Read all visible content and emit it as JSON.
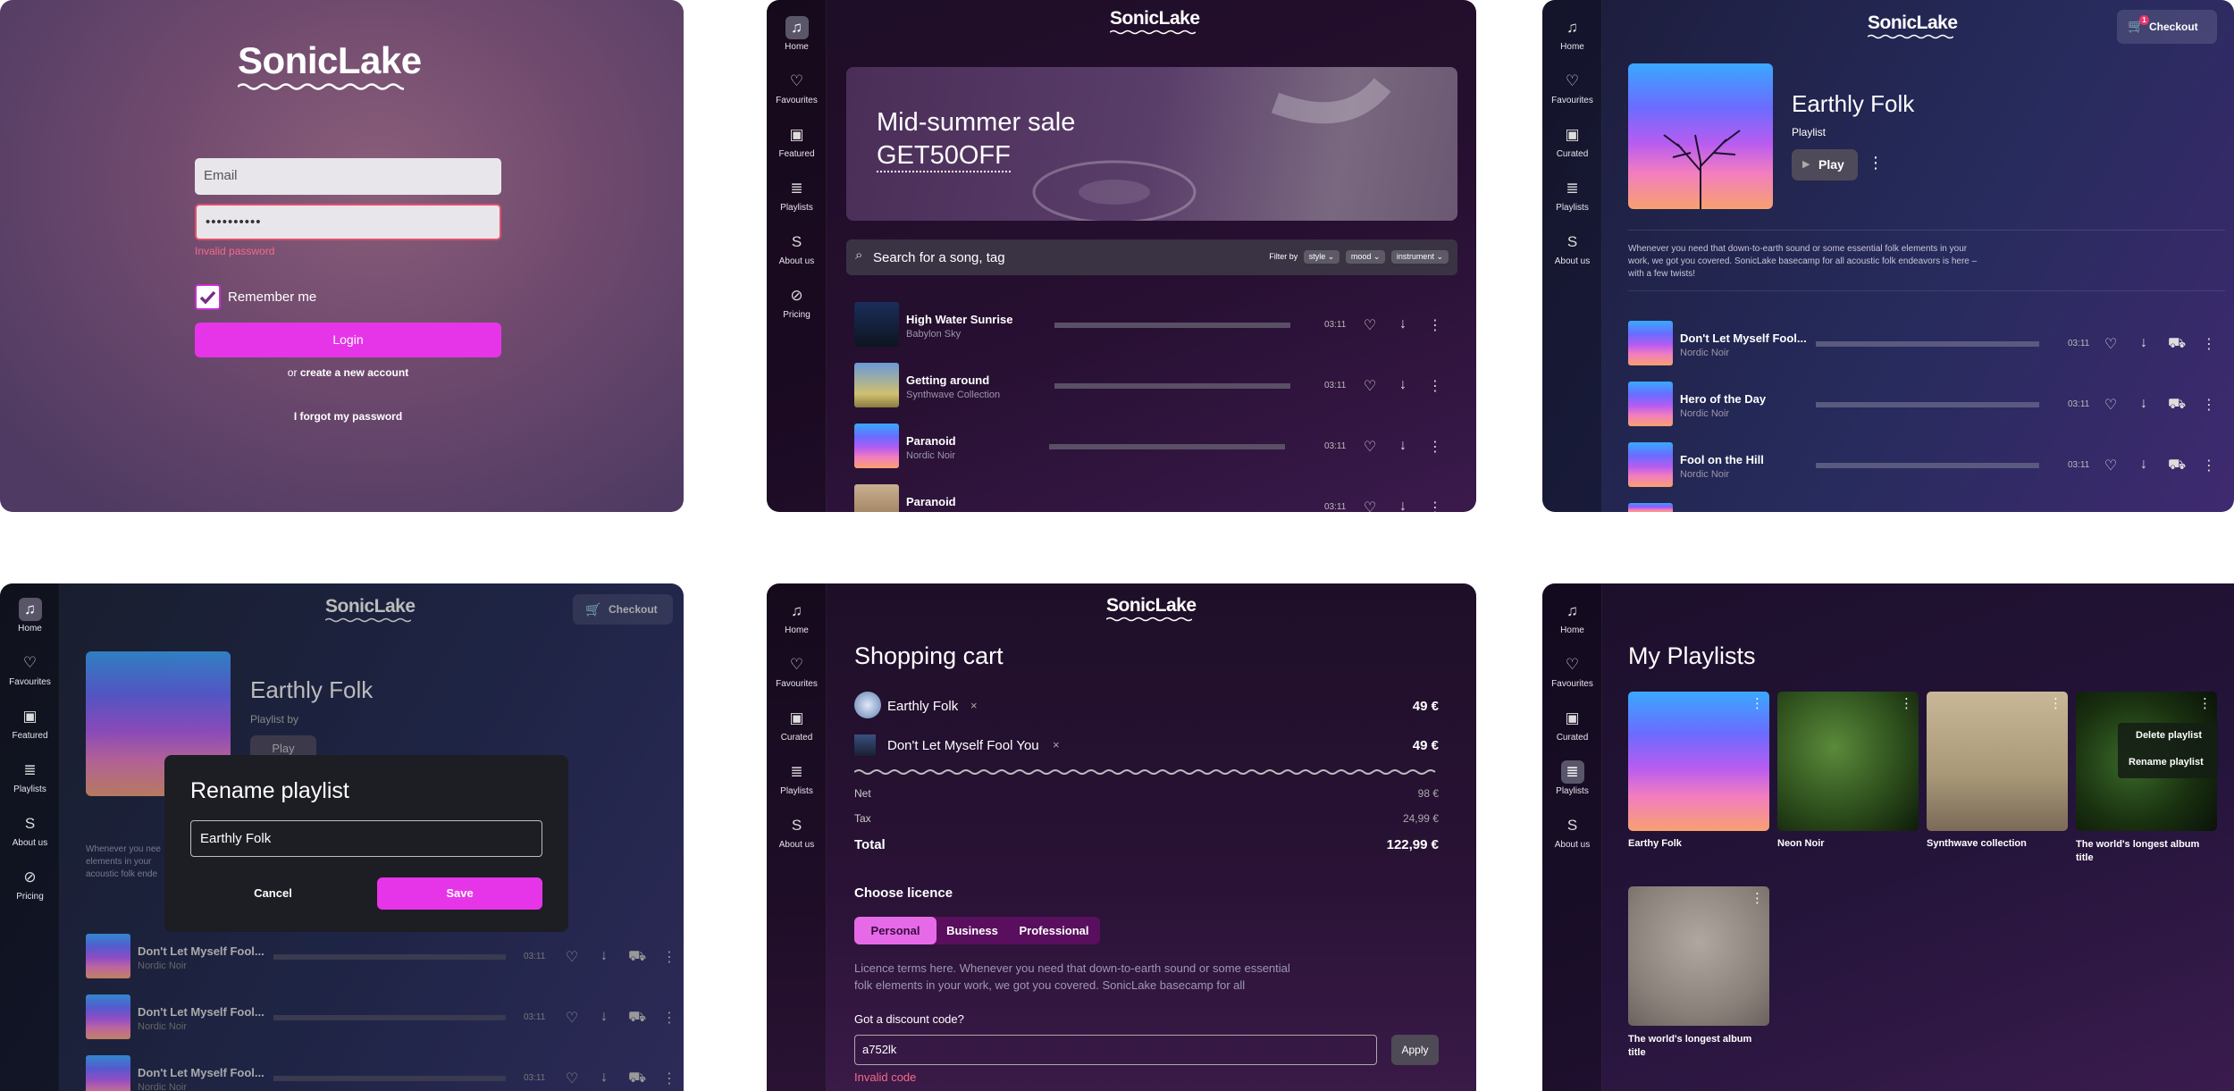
{
  "brand": {
    "name": "SonicLake",
    "accent": "#e635e8"
  },
  "login": {
    "email_placeholder": "Email",
    "password_value": "••••••••••",
    "error": "Invalid password",
    "remember": "Remember me",
    "login_btn": "Login",
    "or_text": "or",
    "create_link": "create a new account",
    "forgot": "I forgot my password"
  },
  "nav_main": [
    {
      "label": "Home",
      "icon": "music-note-icon"
    },
    {
      "label": "Favourites",
      "icon": "heart-icon"
    },
    {
      "label": "Featured",
      "icon": "featured-icon"
    },
    {
      "label": "Playlists",
      "icon": "playlist-icon"
    },
    {
      "label": "About us",
      "icon": "about-icon"
    },
    {
      "label": "Pricing",
      "icon": "pricing-icon"
    }
  ],
  "nav_alt": [
    {
      "label": "Home"
    },
    {
      "label": "Favourites"
    },
    {
      "label": "Curated"
    },
    {
      "label": "Playlists"
    },
    {
      "label": "About us"
    }
  ],
  "browse": {
    "banner_line1": "Mid-summer sale",
    "banner_line2": "GET50OFF",
    "search_placeholder": "Search for a song, tag",
    "filter_by": "Filter by",
    "filters": [
      "style",
      "mood",
      "instrument"
    ],
    "tracks": [
      {
        "title": "High Water Sunrise",
        "artist": "Babylon Sky",
        "duration": "03:11"
      },
      {
        "title": "Getting around",
        "artist": "Synthwave Collection",
        "duration": "03:11"
      },
      {
        "title": "Paranoid",
        "artist": "Nordic Noir",
        "duration": "03:11"
      },
      {
        "title": "Paranoid",
        "artist": "",
        "duration": "03:11"
      }
    ]
  },
  "playlist": {
    "title": "Earthly Folk",
    "type": "Playlist",
    "play": "Play",
    "checkout": "Checkout",
    "cart_count": "1",
    "description": "Whenever you need that down-to-earth sound or some essential folk elements in your work, we got you covered. SonicLake basecamp for all acoustic folk endeavors is here – with a few twists!",
    "tracks": [
      {
        "title": "Don't Let Myself Fool...",
        "artist": "Nordic Noir",
        "duration": "03:11"
      },
      {
        "title": "Hero of the Day",
        "artist": "Nordic Noir",
        "duration": "03:11"
      },
      {
        "title": "Fool on the Hill",
        "artist": "Nordic Noir",
        "duration": "03:11"
      }
    ]
  },
  "rename": {
    "heading": "Rename playlist",
    "value": "Earthly Folk",
    "cancel": "Cancel",
    "save": "Save",
    "bg_title": "Earthly Folk",
    "bg_sub": "Playlist by",
    "bg_play": "Play",
    "checkout": "Checkout",
    "bg_desc": "Whenever you nee elements in your acoustic folk ende",
    "tracks": [
      {
        "title": "Don't Let Myself Fool...",
        "artist": "Nordic Noir",
        "duration": "03:11"
      },
      {
        "title": "Don't Let Myself Fool...",
        "artist": "Nordic Noir",
        "duration": "03:11"
      },
      {
        "title": "Don't Let Myself Fool...",
        "artist": "Nordic Noir",
        "duration": "03:11"
      }
    ]
  },
  "cart": {
    "heading": "Shopping cart",
    "items": [
      {
        "name": "Earthly Folk",
        "price": "49 €"
      },
      {
        "name": "Don't Let Myself Fool You",
        "price": "49 €"
      }
    ],
    "net_label": "Net",
    "net": "98 €",
    "tax_label": "Tax",
    "tax": "24,99 €",
    "total_label": "Total",
    "total": "122,99 €",
    "licence_heading": "Choose licence",
    "licences": [
      "Personal",
      "Business",
      "Professional"
    ],
    "licence_terms": "Licence terms here. Whenever you need that down-to-earth sound or some essential folk elements in your work, we got you covered. SonicLake basecamp for all",
    "discount_label": "Got a discount code?",
    "discount_value": "a752lk",
    "apply": "Apply",
    "discount_error": "Invalid code"
  },
  "my_playlists": {
    "heading": "My Playlists",
    "items": [
      {
        "title": "Earthy Folk"
      },
      {
        "title": "Neon Noir"
      },
      {
        "title": "Synthwave collection"
      },
      {
        "title": "The world's longest album title"
      },
      {
        "title": "The world's longest album title"
      }
    ],
    "menu": [
      "Delete playlist",
      "Rename playlist"
    ]
  }
}
